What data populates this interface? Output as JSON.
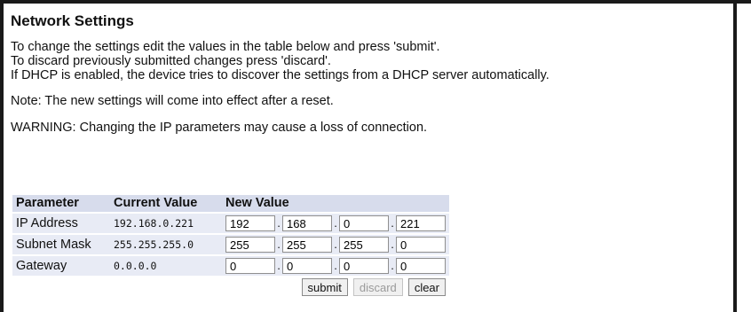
{
  "title": "Network Settings",
  "intro_lines": [
    "To change the settings edit the values in the table below and press 'submit'.",
    "To discard previously submitted changes press 'discard'.",
    "If DHCP is enabled, the device tries to discover the settings from a DHCP server automatically."
  ],
  "note": "Note: The new settings will come into effect after a reset.",
  "warning": "WARNING: Changing the IP parameters may cause a loss of connection.",
  "table": {
    "headers": [
      "Parameter",
      "Current Value",
      "New Value"
    ],
    "rows": [
      {
        "label": "IP Address",
        "current": "192.168.0.221",
        "new": [
          "192",
          "168",
          "0",
          "221"
        ]
      },
      {
        "label": "Subnet Mask",
        "current": "255.255.255.0",
        "new": [
          "255",
          "255",
          "255",
          "0"
        ]
      },
      {
        "label": "Gateway",
        "current": "0.0.0.0",
        "new": [
          "0",
          "0",
          "0",
          "0"
        ]
      }
    ]
  },
  "separator": ".",
  "buttons": {
    "submit": "submit",
    "discard": "discard",
    "clear": "clear"
  }
}
